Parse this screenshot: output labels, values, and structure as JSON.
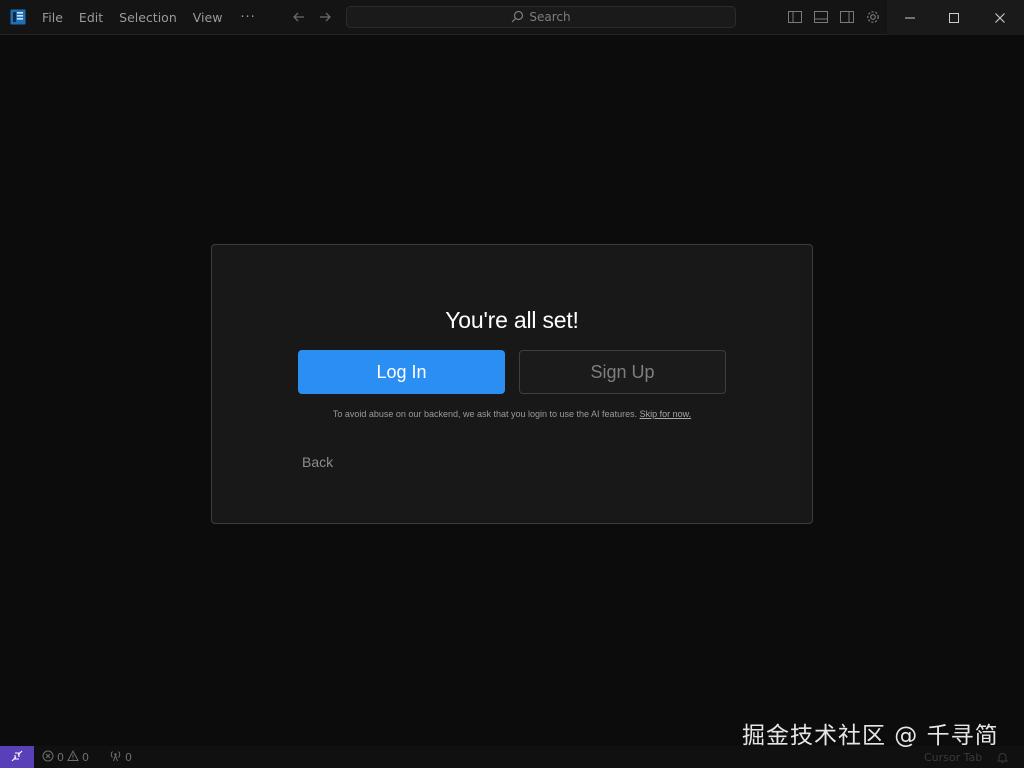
{
  "menu": {
    "items": [
      "File",
      "Edit",
      "Selection",
      "View"
    ],
    "more_label": "···"
  },
  "search": {
    "placeholder": "Search"
  },
  "dialog": {
    "title": "You're all set!",
    "login_label": "Log In",
    "signup_label": "Sign Up",
    "notice_text": "To avoid abuse on our backend, we ask that you login to use the AI features.",
    "skip_label": "Skip for now.",
    "back_label": "Back"
  },
  "status": {
    "errors": "0",
    "warnings": "0",
    "ports": "0",
    "cursor_tab": "Cursor Tab"
  },
  "watermark": "掘金技术社区 @ 千寻简",
  "colors": {
    "accent": "#2a8ef2",
    "remote": "#5b3fb8",
    "background": "#0c0c0c",
    "dialog": "#181818"
  }
}
